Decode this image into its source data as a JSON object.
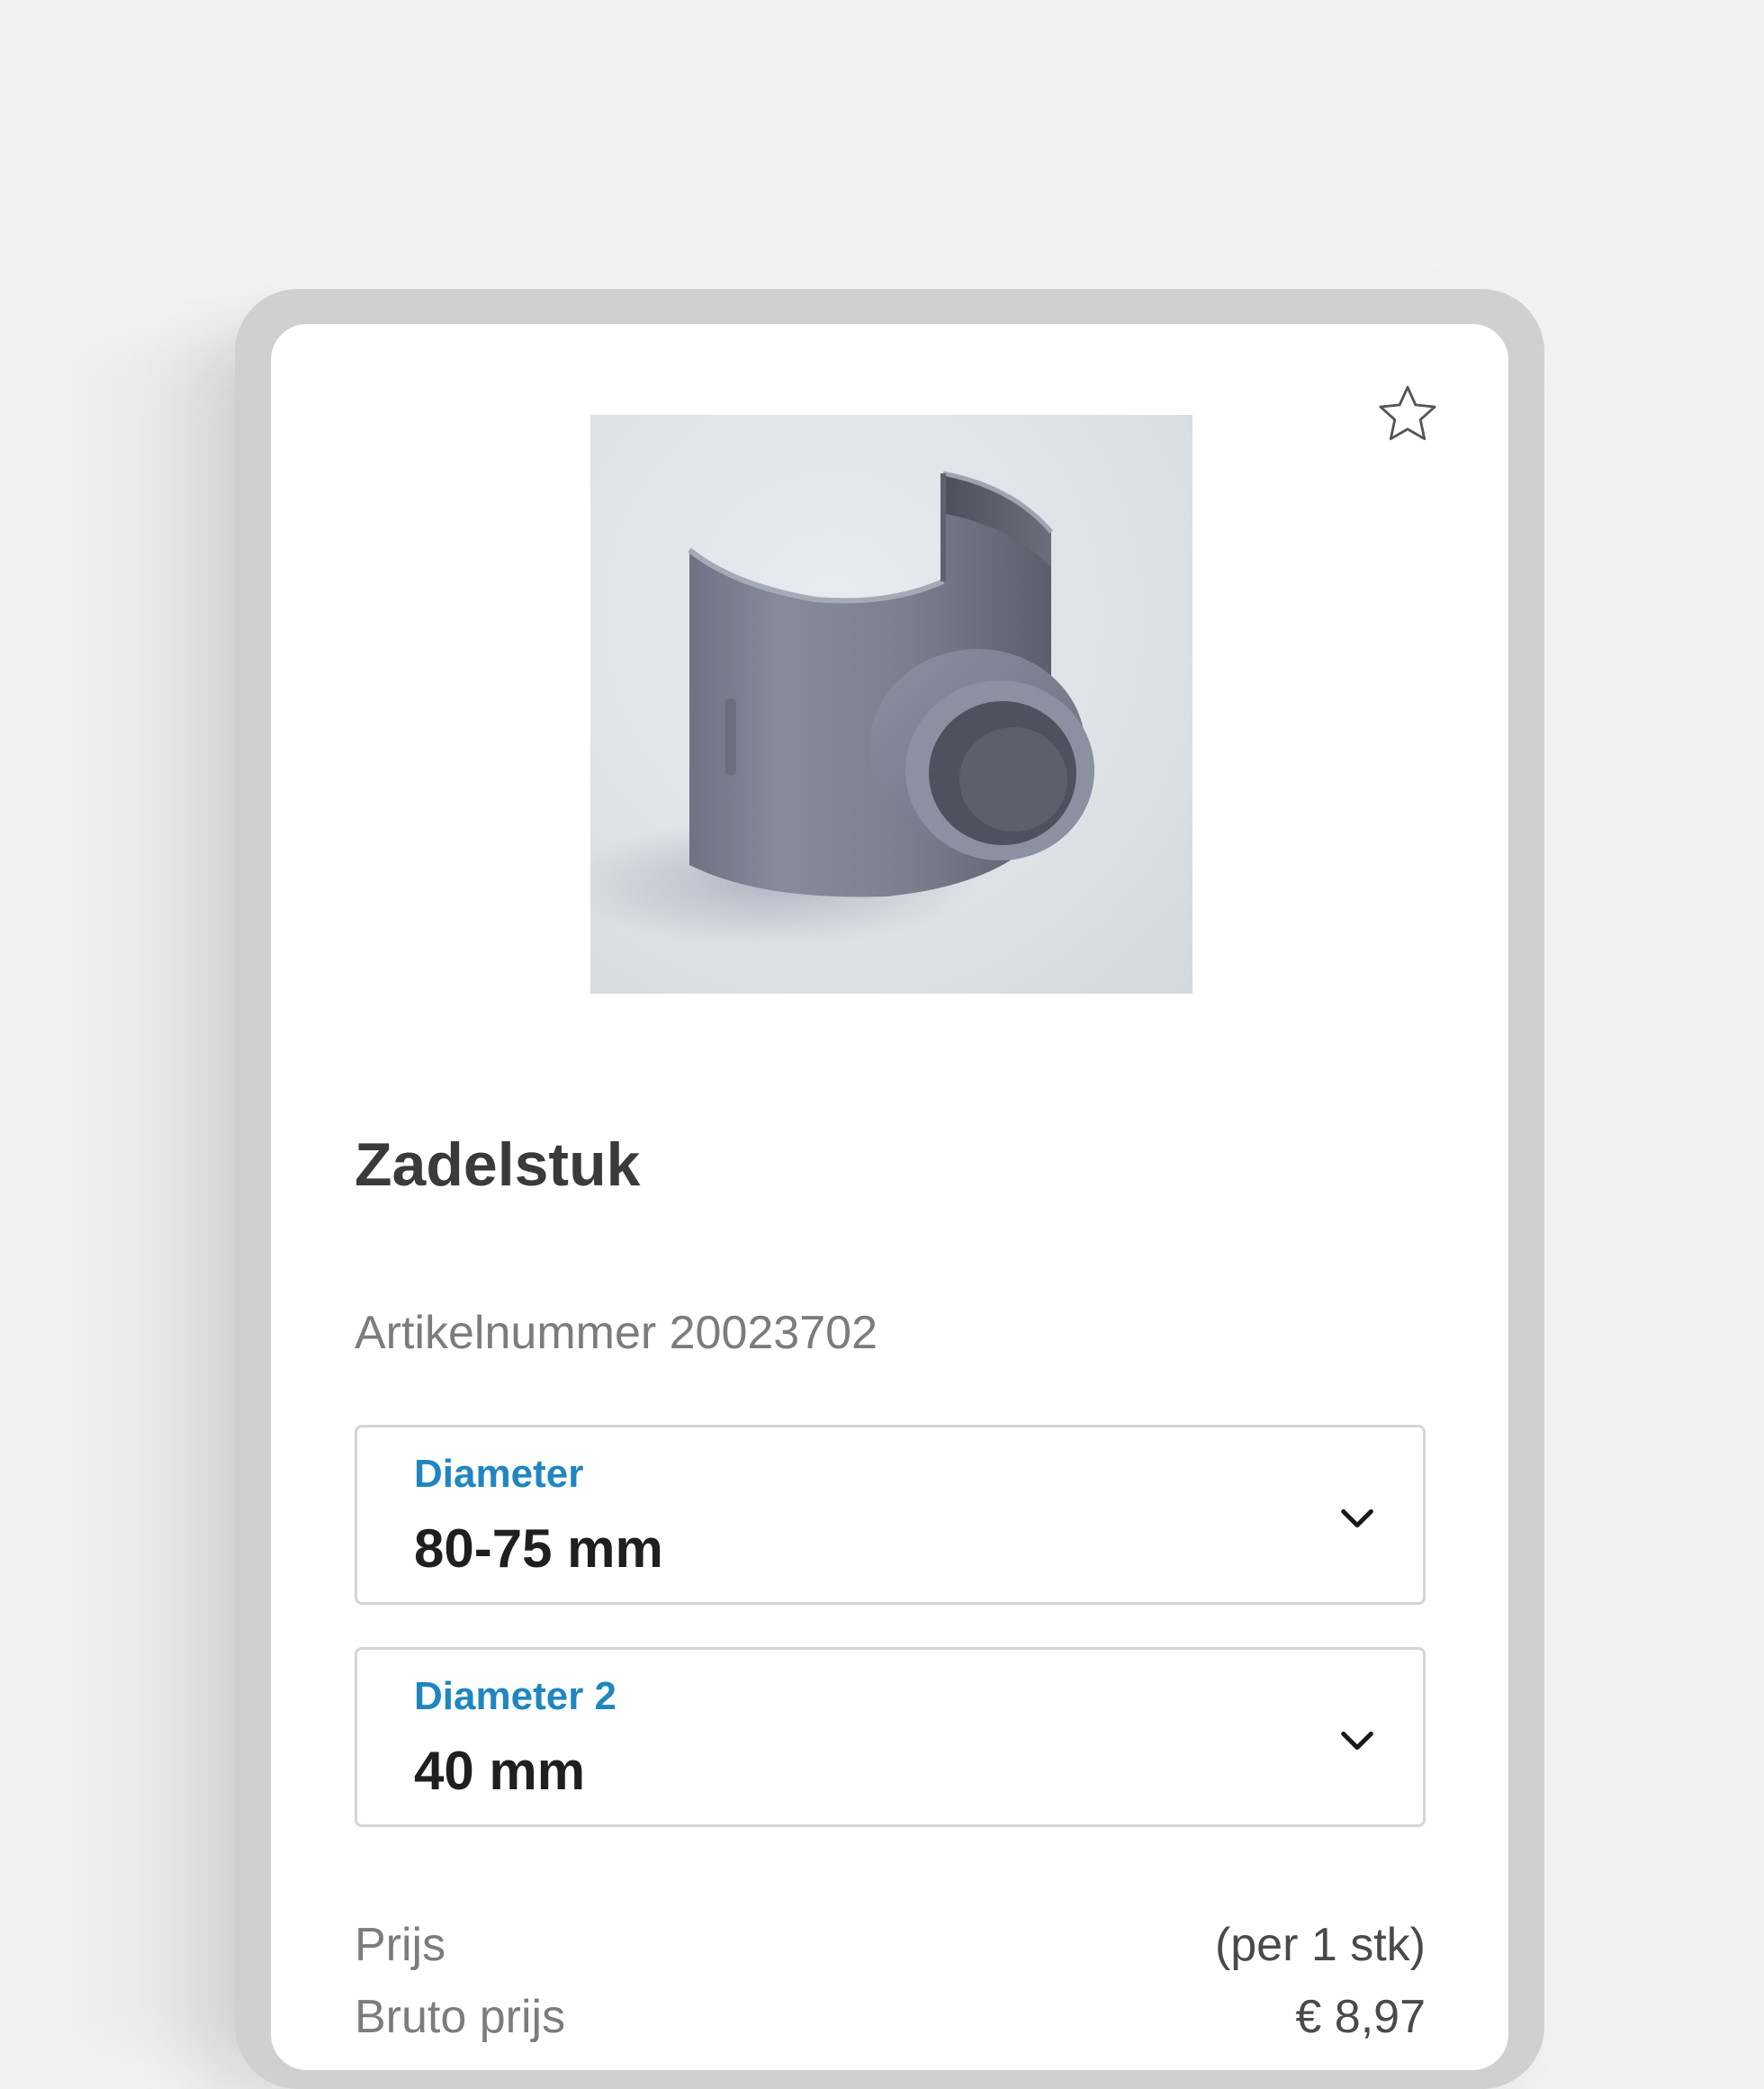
{
  "product": {
    "title": "Zadelstuk",
    "article_line": "Artikelnummer 20023702",
    "favorite_icon": "star-outline-icon"
  },
  "selects": [
    {
      "label": "Diameter",
      "value": "80-75 mm",
      "icon": "chevron-down-icon"
    },
    {
      "label": "Diameter 2",
      "value": "40 mm",
      "icon": "chevron-down-icon"
    }
  ],
  "price": {
    "label": "Prijs",
    "unit": "(per 1 stk)",
    "gross_label": "Bruto prijs",
    "gross_value": "€ 8,97"
  },
  "colors": {
    "accent": "#1f86c1",
    "title": "#3a3a3a",
    "muted": "#7c7c7c",
    "frame": "#d0d0d0",
    "background": "#f2f2f2"
  }
}
